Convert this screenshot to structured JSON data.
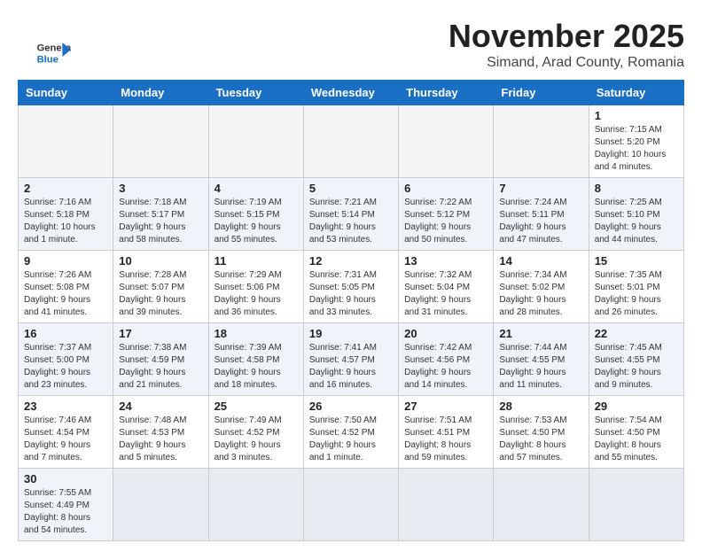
{
  "header": {
    "month_year": "November 2025",
    "location": "Simand, Arad County, Romania"
  },
  "logo": {
    "general": "General",
    "blue": "Blue"
  },
  "days_of_week": [
    "Sunday",
    "Monday",
    "Tuesday",
    "Wednesday",
    "Thursday",
    "Friday",
    "Saturday"
  ],
  "weeks": [
    [
      {
        "day": "",
        "info": ""
      },
      {
        "day": "",
        "info": ""
      },
      {
        "day": "",
        "info": ""
      },
      {
        "day": "",
        "info": ""
      },
      {
        "day": "",
        "info": ""
      },
      {
        "day": "",
        "info": ""
      },
      {
        "day": "1",
        "info": "Sunrise: 7:15 AM\nSunset: 5:20 PM\nDaylight: 10 hours and 4 minutes."
      }
    ],
    [
      {
        "day": "2",
        "info": "Sunrise: 7:16 AM\nSunset: 5:18 PM\nDaylight: 10 hours and 1 minute."
      },
      {
        "day": "3",
        "info": "Sunrise: 7:18 AM\nSunset: 5:17 PM\nDaylight: 9 hours and 58 minutes."
      },
      {
        "day": "4",
        "info": "Sunrise: 7:19 AM\nSunset: 5:15 PM\nDaylight: 9 hours and 55 minutes."
      },
      {
        "day": "5",
        "info": "Sunrise: 7:21 AM\nSunset: 5:14 PM\nDaylight: 9 hours and 53 minutes."
      },
      {
        "day": "6",
        "info": "Sunrise: 7:22 AM\nSunset: 5:12 PM\nDaylight: 9 hours and 50 minutes."
      },
      {
        "day": "7",
        "info": "Sunrise: 7:24 AM\nSunset: 5:11 PM\nDaylight: 9 hours and 47 minutes."
      },
      {
        "day": "8",
        "info": "Sunrise: 7:25 AM\nSunset: 5:10 PM\nDaylight: 9 hours and 44 minutes."
      }
    ],
    [
      {
        "day": "9",
        "info": "Sunrise: 7:26 AM\nSunset: 5:08 PM\nDaylight: 9 hours and 41 minutes."
      },
      {
        "day": "10",
        "info": "Sunrise: 7:28 AM\nSunset: 5:07 PM\nDaylight: 9 hours and 39 minutes."
      },
      {
        "day": "11",
        "info": "Sunrise: 7:29 AM\nSunset: 5:06 PM\nDaylight: 9 hours and 36 minutes."
      },
      {
        "day": "12",
        "info": "Sunrise: 7:31 AM\nSunset: 5:05 PM\nDaylight: 9 hours and 33 minutes."
      },
      {
        "day": "13",
        "info": "Sunrise: 7:32 AM\nSunset: 5:04 PM\nDaylight: 9 hours and 31 minutes."
      },
      {
        "day": "14",
        "info": "Sunrise: 7:34 AM\nSunset: 5:02 PM\nDaylight: 9 hours and 28 minutes."
      },
      {
        "day": "15",
        "info": "Sunrise: 7:35 AM\nSunset: 5:01 PM\nDaylight: 9 hours and 26 minutes."
      }
    ],
    [
      {
        "day": "16",
        "info": "Sunrise: 7:37 AM\nSunset: 5:00 PM\nDaylight: 9 hours and 23 minutes."
      },
      {
        "day": "17",
        "info": "Sunrise: 7:38 AM\nSunset: 4:59 PM\nDaylight: 9 hours and 21 minutes."
      },
      {
        "day": "18",
        "info": "Sunrise: 7:39 AM\nSunset: 4:58 PM\nDaylight: 9 hours and 18 minutes."
      },
      {
        "day": "19",
        "info": "Sunrise: 7:41 AM\nSunset: 4:57 PM\nDaylight: 9 hours and 16 minutes."
      },
      {
        "day": "20",
        "info": "Sunrise: 7:42 AM\nSunset: 4:56 PM\nDaylight: 9 hours and 14 minutes."
      },
      {
        "day": "21",
        "info": "Sunrise: 7:44 AM\nSunset: 4:55 PM\nDaylight: 9 hours and 11 minutes."
      },
      {
        "day": "22",
        "info": "Sunrise: 7:45 AM\nSunset: 4:55 PM\nDaylight: 9 hours and 9 minutes."
      }
    ],
    [
      {
        "day": "23",
        "info": "Sunrise: 7:46 AM\nSunset: 4:54 PM\nDaylight: 9 hours and 7 minutes."
      },
      {
        "day": "24",
        "info": "Sunrise: 7:48 AM\nSunset: 4:53 PM\nDaylight: 9 hours and 5 minutes."
      },
      {
        "day": "25",
        "info": "Sunrise: 7:49 AM\nSunset: 4:52 PM\nDaylight: 9 hours and 3 minutes."
      },
      {
        "day": "26",
        "info": "Sunrise: 7:50 AM\nSunset: 4:52 PM\nDaylight: 9 hours and 1 minute."
      },
      {
        "day": "27",
        "info": "Sunrise: 7:51 AM\nSunset: 4:51 PM\nDaylight: 8 hours and 59 minutes."
      },
      {
        "day": "28",
        "info": "Sunrise: 7:53 AM\nSunset: 4:50 PM\nDaylight: 8 hours and 57 minutes."
      },
      {
        "day": "29",
        "info": "Sunrise: 7:54 AM\nSunset: 4:50 PM\nDaylight: 8 hours and 55 minutes."
      }
    ],
    [
      {
        "day": "30",
        "info": "Sunrise: 7:55 AM\nSunset: 4:49 PM\nDaylight: 8 hours and 54 minutes."
      },
      {
        "day": "",
        "info": ""
      },
      {
        "day": "",
        "info": ""
      },
      {
        "day": "",
        "info": ""
      },
      {
        "day": "",
        "info": ""
      },
      {
        "day": "",
        "info": ""
      },
      {
        "day": "",
        "info": ""
      }
    ]
  ]
}
